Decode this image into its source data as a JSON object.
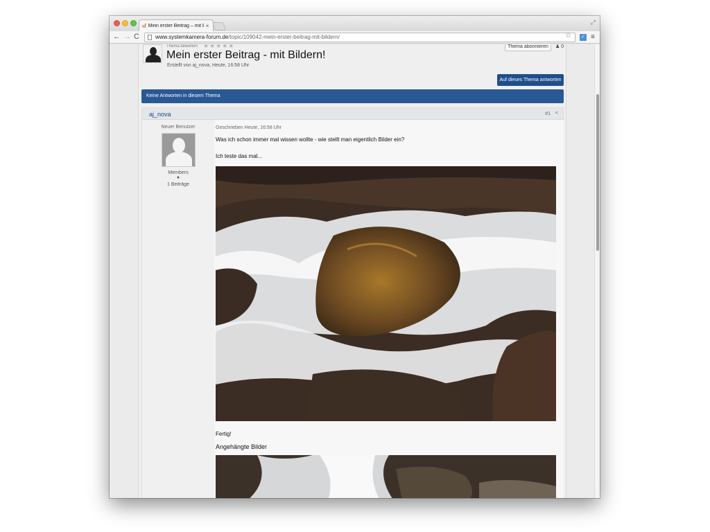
{
  "browser": {
    "tab_favicon": "sf",
    "tab_title": "Mein erster Beitrag – mit B",
    "tab_close": "×",
    "url_host": "www.systemkamera-forum.de",
    "url_path": "/topic/109042-mein-erster-beitrag-mit-bildern/",
    "back_icon": "←",
    "forward_icon": "→",
    "reload_icon": "C",
    "star_icon": "☆",
    "menu_icon": "≡",
    "resize_icon": "⤢"
  },
  "topic": {
    "rate_label": "Thema bewerten",
    "stars": "★★★★★",
    "title": "Mein erster Beitrag - mit Bildern!",
    "meta": "Erstellt von aj_nova, Heute, 16:58 Uhr",
    "follow_label": "Thema abonnieren",
    "follower_count": "0",
    "reply_label": "Auf dieses Thema antworten",
    "no_replies": "Keine Antworten in diesem Thema"
  },
  "post": {
    "author": "aj_nova",
    "number": "#1",
    "share_icon": "<",
    "member_title": "Neuer Benutzer",
    "group": "Members",
    "dot": "●",
    "post_count": "1 Beiträge",
    "date": "Geschrieben Heute, 16:58 Uhr",
    "text1": "Was ich schon immer mal wissen wollte - wie stellt man eigentlich Bilder ein?",
    "text2": "Ich teste das mal...",
    "text3": "Fertig!",
    "attachments_heading": "Angehängte Bilder"
  },
  "colors": {
    "accent": "#1f4e8b",
    "bar": "#2a5894",
    "author_link": "#1d4a7d"
  }
}
